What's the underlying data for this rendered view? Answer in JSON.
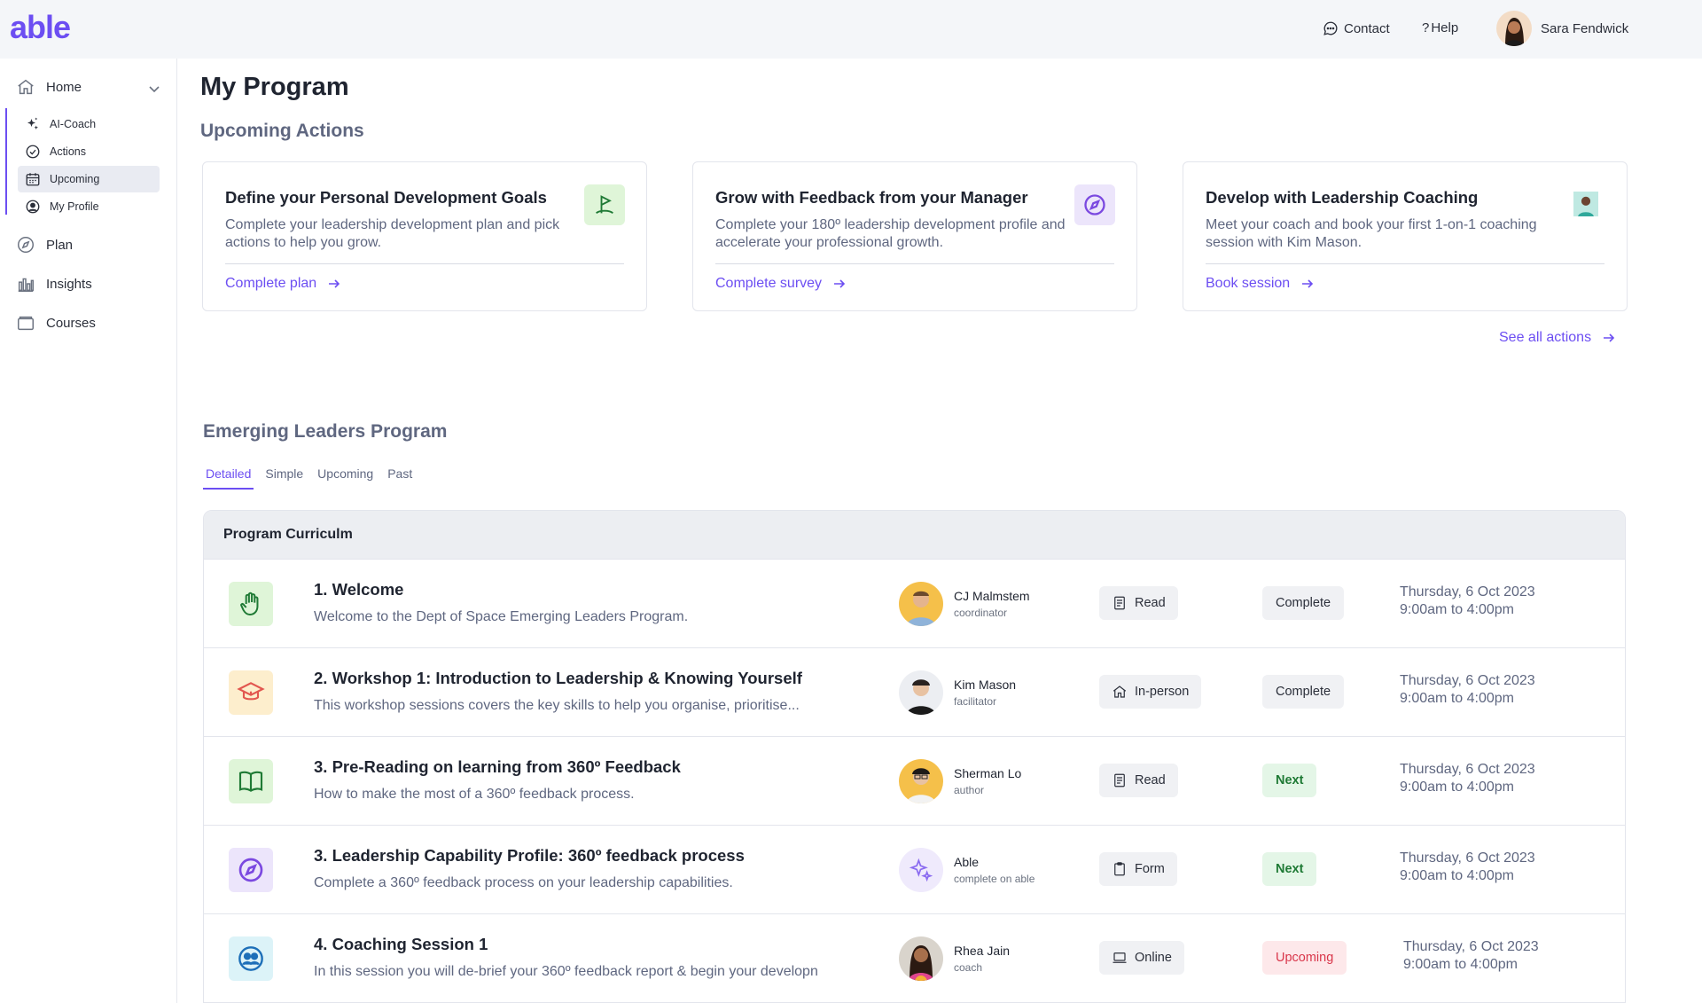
{
  "app": {
    "logo": "able"
  },
  "topbar": {
    "contact": "Contact",
    "help": "Help",
    "user_name": "Sara Fendwick"
  },
  "sidebar": {
    "home": "Home",
    "sub_items": [
      "AI-Coach",
      "Actions",
      "Upcoming",
      "My Profile"
    ],
    "active_sub": "Upcoming",
    "plan": "Plan",
    "insights": "Insights",
    "courses": "Courses"
  },
  "main": {
    "title": "My Program",
    "upcoming_title": "Upcoming Actions",
    "cards": [
      {
        "title": "Define your Personal Development Goals",
        "desc": "Complete your leadership development plan and pick actions to help you grow.",
        "link": "Complete plan",
        "icon": "flag-icon",
        "color": "#dff5d8"
      },
      {
        "title": "Grow with Feedback from your Manager",
        "desc": "Complete your 180º leadership development profile and accelerate your professional growth.",
        "link": "Complete survey",
        "icon": "compass-icon",
        "color": "#ece5fb"
      },
      {
        "title": "Develop with Leadership Coaching",
        "desc": "Meet your coach and book your first 1-on-1 coaching session with Kim Mason.",
        "link": "Book session",
        "icon": "coach-avatar",
        "color": "#ffffff"
      }
    ],
    "see_all": "See all actions",
    "program_title": "Emerging Leaders Program",
    "tabs": [
      "Detailed",
      "Simple",
      "Upcoming",
      "Past"
    ],
    "active_tab": "Detailed",
    "curriculum": {
      "header": "Program Curriculm",
      "rows": [
        {
          "title": "1. Welcome",
          "desc": "Welcome to the Dept of Space Emerging Leaders Program.",
          "icon": "hand-icon",
          "person": "CJ Malmstem",
          "role": "coordinator",
          "type": "Read",
          "type_icon": "document-icon",
          "status": "Complete",
          "date": "Thursday, 6 Oct 2023",
          "time": "9:00am to 4:00pm"
        },
        {
          "title": "2. Workshop 1: Introduction to Leadership & Knowing Yourself",
          "desc": "This workshop sessions covers the key skills to help you organise, prioritise...",
          "icon": "graduation-cap-icon",
          "person": "Kim Mason",
          "role": "facilitator",
          "type": "In-person",
          "type_icon": "house-icon",
          "status": "Complete",
          "date": "Thursday, 6 Oct 2023",
          "time": "9:00am to 4:00pm"
        },
        {
          "title": "3. Pre-Reading on learning from 360º Feedback",
          "desc": "How to make the most of a 360º feedback process.",
          "icon": "book-icon",
          "person": "Sherman Lo",
          "role": "author",
          "type": "Read",
          "type_icon": "document-icon",
          "status": "Next",
          "date": "Thursday, 6 Oct 2023",
          "time": "9:00am to 4:00pm"
        },
        {
          "title": "3. Leadership Capability Profile: 360º feedback process",
          "desc": "Complete a 360º feedback process on your leadership capabilities.",
          "icon": "compass-icon",
          "person": "Able",
          "role": "complete on able",
          "type": "Form",
          "type_icon": "clipboard-icon",
          "status": "Next",
          "date": "Thursday, 6 Oct 2023",
          "time": "9:00am to 4:00pm"
        },
        {
          "title": "4. Coaching Session 1",
          "desc": "In this session you will de-brief your 360º feedback report & begin your developn",
          "icon": "people-icon",
          "person": "Rhea Jain",
          "role": "coach",
          "type": "Online",
          "type_icon": "laptop-icon",
          "status": "Upcoming",
          "date": "Thursday, 6 Oct 2023",
          "time": "9:00am to 4:00pm"
        }
      ]
    }
  },
  "colors": {
    "accent": "#6c4ef2",
    "next_green": "#1f7a35",
    "upcoming_red": "#d9364a"
  }
}
